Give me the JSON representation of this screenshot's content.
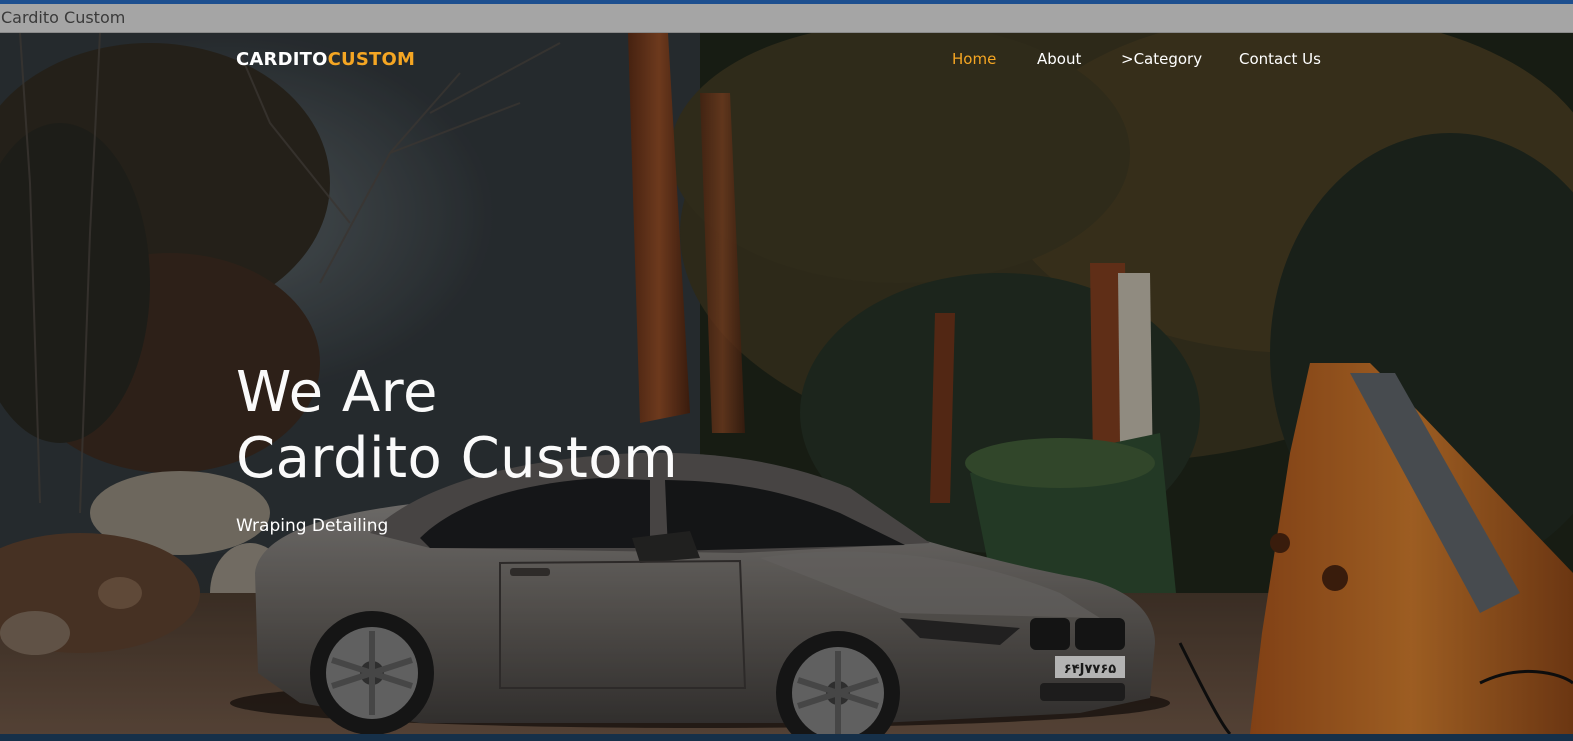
{
  "window": {
    "title": "Cardito Custom"
  },
  "header": {
    "logo_primary": "CARDITO",
    "logo_secondary": "CUSTOM",
    "nav": [
      {
        "label": "Home",
        "active": true
      },
      {
        "label": "About",
        "active": false
      },
      {
        "label": ">Category",
        "active": false
      },
      {
        "label": "Contact Us",
        "active": false
      }
    ]
  },
  "hero": {
    "headline_line1": "We Are",
    "headline_line2": "Cardito Custom",
    "tagline": "Wraping Detailing",
    "background_image": "photo of grey convertible sports car among trees and an orange excavator arm",
    "plate": "۶۴J۷۷۶۵"
  },
  "colors": {
    "accent": "#f5a623",
    "top_accent": "#1d4f8f",
    "titlebar": "#a5a5a5",
    "text": "#ffffff"
  }
}
